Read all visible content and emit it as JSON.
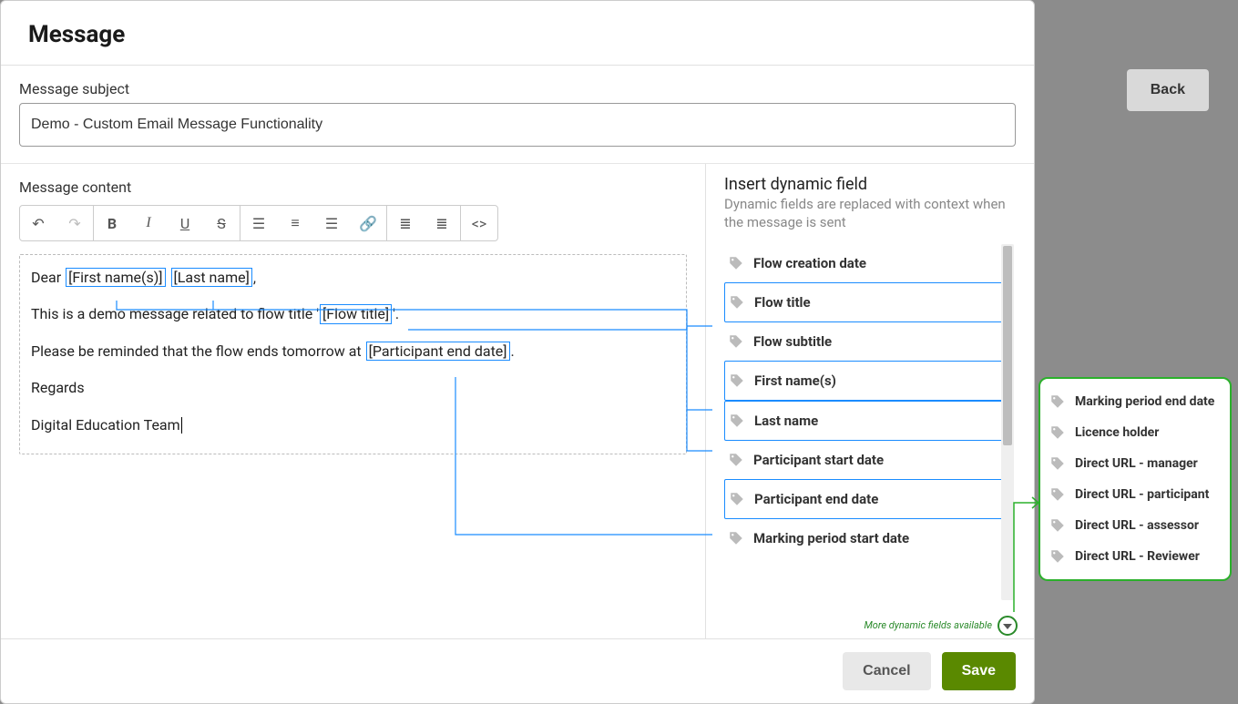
{
  "modal": {
    "title": "Message",
    "subject_label": "Message subject",
    "subject_value": "Demo - Custom Email Message Functionality",
    "content_label": "Message content"
  },
  "editor": {
    "p1_prefix": "Dear ",
    "token_firstname": "[First name(s)]",
    "token_lastname": "[Last name]",
    "p1_suffix": ",",
    "p2_prefix": "This is a demo message related to flow title '",
    "token_flowtitle": "[Flow title]",
    "p2_suffix": "'.",
    "p3_prefix": "Please be reminded that the flow ends tomorrow at ",
    "token_ped": "[Participant end date]",
    "p3_suffix": ".",
    "p4": "Regards",
    "p5": "Digital Education Team"
  },
  "side": {
    "title": "Insert dynamic field",
    "desc": "Dynamic fields are replaced with context when the message is sent",
    "items": [
      {
        "label": "Flow creation date",
        "boxed": false
      },
      {
        "label": "Flow title",
        "boxed": true
      },
      {
        "label": "Flow subtitle",
        "boxed": false
      },
      {
        "label": "First name(s)",
        "boxed": true
      },
      {
        "label": "Last name",
        "boxed": true
      },
      {
        "label": "Participant start date",
        "boxed": false
      },
      {
        "label": "Participant end date",
        "boxed": true
      },
      {
        "label": "Marking period start date",
        "boxed": false
      }
    ],
    "more_note": "More dynamic fields available"
  },
  "popout": {
    "items": [
      "Marking period end date",
      "Licence holder",
      "Direct URL - manager",
      "Direct URL - participant",
      "Direct URL - assessor",
      "Direct URL - Reviewer"
    ]
  },
  "footer": {
    "cancel": "Cancel",
    "save": "Save"
  },
  "back": {
    "label": "Back"
  }
}
